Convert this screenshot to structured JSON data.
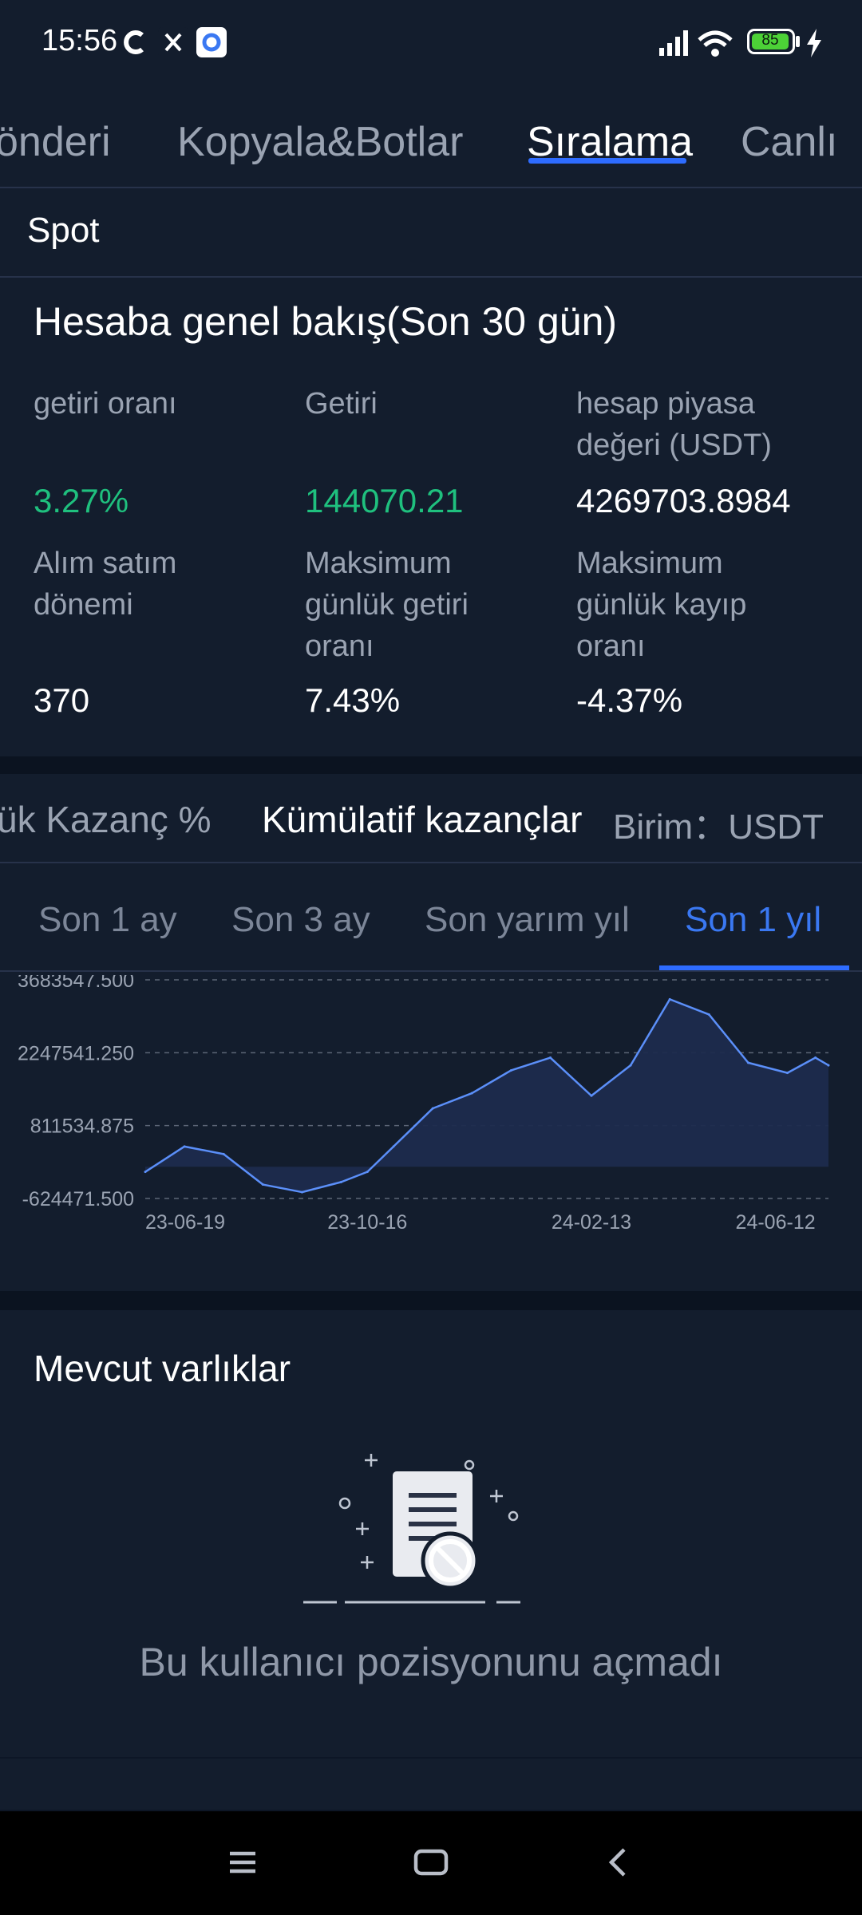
{
  "status_bar": {
    "time": "15:56",
    "battery": "85",
    "icons": [
      "c-app-icon",
      "x-app-icon",
      "google-app-icon",
      "signal-icon",
      "wifi-icon",
      "battery-icon",
      "charging-icon"
    ]
  },
  "top_tabs": {
    "items": [
      {
        "label": "önderi"
      },
      {
        "label": "Kopyala&Botlar"
      },
      {
        "label": "Sıralama"
      },
      {
        "label": "Canlı"
      }
    ],
    "active": "Sıralama"
  },
  "spot": {
    "label": "Spot"
  },
  "overview": {
    "title": "Hesaba genel bakış(Son 30 gün)",
    "stats": [
      {
        "label": "getiri oranı",
        "value": "3.27%"
      },
      {
        "label": "Getiri",
        "value": "144070.21"
      },
      {
        "label": "hesap piyasa değeri (USDT)",
        "value": "4269703.8984"
      },
      {
        "label": "Alım satım dönemi",
        "value": "370"
      },
      {
        "label": "Maksimum günlük getiri oranı",
        "value": "7.43%"
      },
      {
        "label": "Maksimum günlük kayıp oranı",
        "value": "-4.37%"
      }
    ]
  },
  "chart_tabs": {
    "items": [
      {
        "label": "ük Kazanç %"
      },
      {
        "label": "Kümülatif kazançlar"
      }
    ],
    "unit_label": "Birim：USDT"
  },
  "period_tabs": {
    "items": [
      {
        "label": "Son 1 ay"
      },
      {
        "label": "Son 3 ay"
      },
      {
        "label": "Son yarım yıl"
      },
      {
        "label": "Son 1 yıl"
      }
    ],
    "active": "Son 1 yıl"
  },
  "chart_data": {
    "type": "area",
    "title": "",
    "xlabel": "",
    "ylabel": "",
    "y_ticks": [
      "3683547.500",
      "2247541.250",
      "811534.875",
      "-624471.500"
    ],
    "ylim": [
      -624471.5,
      3683547.5
    ],
    "x_ticks": [
      "23-06-19",
      "23-10-16",
      "24-02-13",
      "24-06-12"
    ],
    "grid": true,
    "series": [
      {
        "color": "#5b8ff9",
        "x": [
          "23-06-19",
          "23-07-10",
          "23-07-31",
          "23-08-21",
          "23-09-11",
          "23-10-02",
          "23-10-16",
          "23-10-30",
          "23-11-20",
          "23-12-11",
          "24-01-01",
          "24-01-22",
          "24-02-13",
          "24-03-05",
          "24-03-26",
          "24-04-16",
          "24-05-07",
          "24-05-28",
          "24-06-12",
          "24-06-19"
        ],
        "values": [
          -100000,
          400000,
          250000,
          -350000,
          -500000,
          -300000,
          -100000,
          400000,
          1150000,
          1450000,
          1900000,
          2150000,
          1400000,
          2000000,
          3300000,
          3000000,
          2050000,
          1850000,
          2150000,
          2000000
        ]
      }
    ]
  },
  "holdings": {
    "title": "Mevcut varlıklar",
    "empty_text": "Bu kullanıcı pozisyonunu açmadı"
  },
  "nav_bar": {
    "icons": [
      "menu-icon",
      "home-icon",
      "back-icon"
    ]
  }
}
